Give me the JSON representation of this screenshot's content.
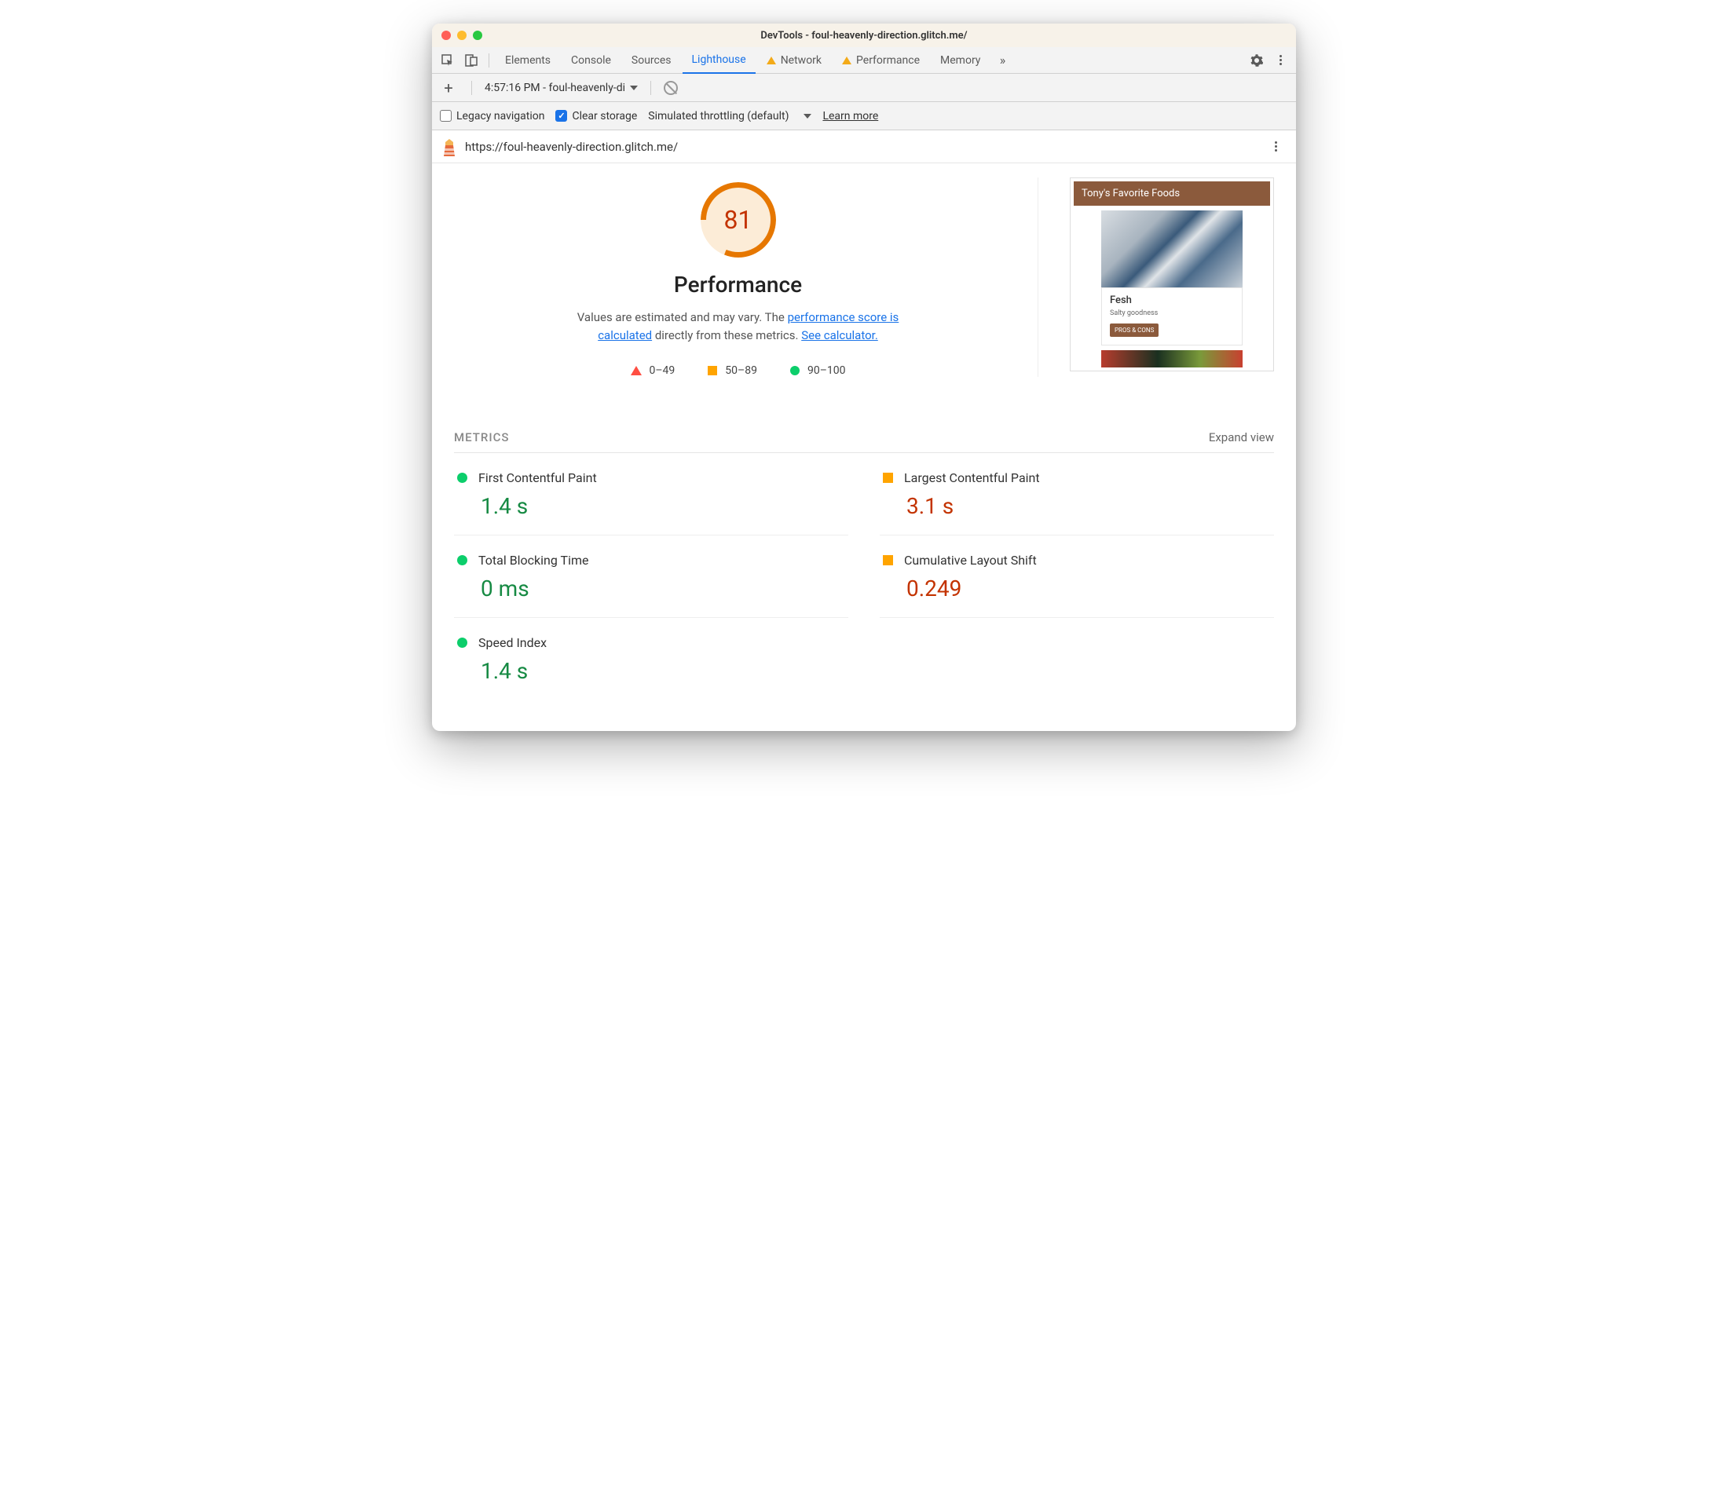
{
  "window": {
    "title": "DevTools - foul-heavenly-direction.glitch.me/"
  },
  "tabs": {
    "items": [
      "Elements",
      "Console",
      "Sources",
      "Lighthouse",
      "Network",
      "Performance",
      "Memory"
    ],
    "active": "Lighthouse",
    "warn": [
      "Network",
      "Performance"
    ]
  },
  "secondbar": {
    "report_label": "4:57:16 PM - foul-heavenly-di"
  },
  "thirdbar": {
    "legacy_label": "Legacy navigation",
    "clear_label": "Clear storage",
    "throttle_label": "Simulated throttling (default)",
    "learn_label": "Learn more"
  },
  "urlbar": {
    "url": "https://foul-heavenly-direction.glitch.me/"
  },
  "score": {
    "value": "81",
    "title": "Performance",
    "desc_prefix": "Values are estimated and may vary. The ",
    "link1": "performance score is calculated",
    "desc_mid": " directly from these metrics. ",
    "link2": "See calculator."
  },
  "legend": {
    "r0": "0–49",
    "r1": "50–89",
    "r2": "90–100"
  },
  "preview": {
    "header": "Tony's Favorite Foods",
    "card_title": "Fesh",
    "card_sub": "Salty goodness",
    "btn": "PROS & CONS"
  },
  "metrics": {
    "header": "METRICS",
    "expand": "Expand view",
    "items": [
      {
        "label": "First Contentful Paint",
        "value": "1.4 s",
        "status": "green",
        "shape": "dot"
      },
      {
        "label": "Largest Contentful Paint",
        "value": "3.1 s",
        "status": "orange",
        "shape": "sq"
      },
      {
        "label": "Total Blocking Time",
        "value": "0 ms",
        "status": "green",
        "shape": "dot"
      },
      {
        "label": "Cumulative Layout Shift",
        "value": "0.249",
        "status": "orange",
        "shape": "sq"
      },
      {
        "label": "Speed Index",
        "value": "1.4 s",
        "status": "green",
        "shape": "dot"
      }
    ]
  }
}
